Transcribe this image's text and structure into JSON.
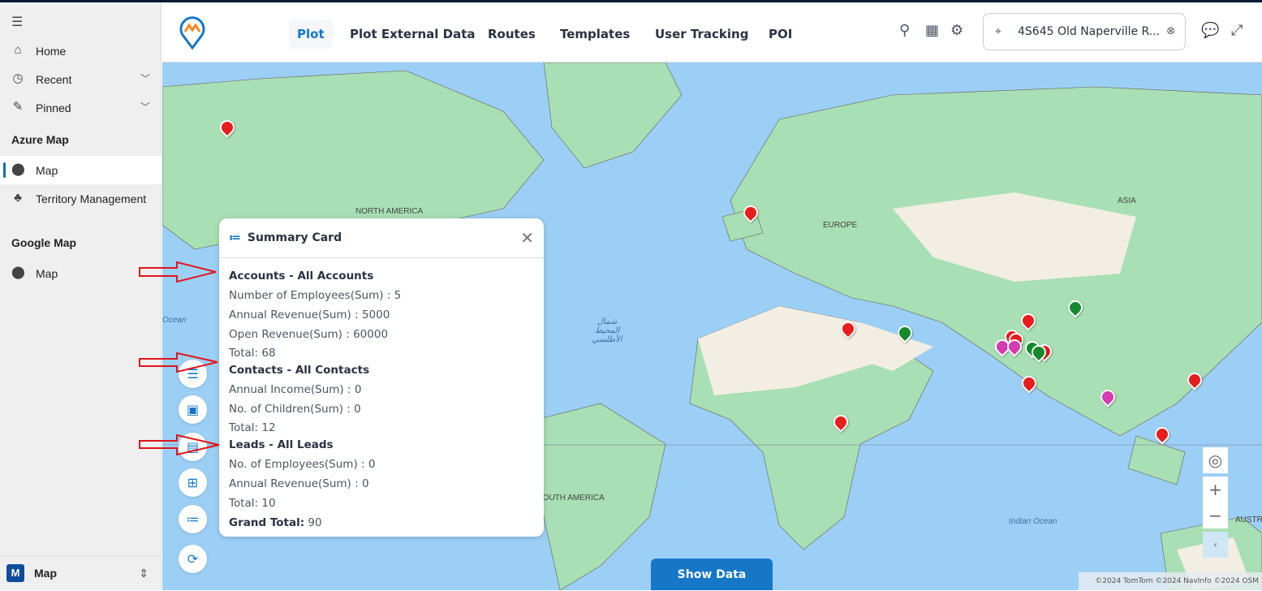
{
  "sidebar": {
    "items": [
      {
        "label": "Home",
        "icon": "home-icon"
      },
      {
        "label": "Recent",
        "icon": "clock-icon"
      },
      {
        "label": "Pinned",
        "icon": "pin-icon"
      }
    ],
    "azure_heading": "Azure Map",
    "azure_items": [
      {
        "label": "Map"
      },
      {
        "label": "Territory Management"
      }
    ],
    "google_heading": "Google Map",
    "google_items": [
      {
        "label": "Map"
      }
    ],
    "area": {
      "badge": "M",
      "label": "Map"
    }
  },
  "header": {
    "tabs": [
      "Plot",
      "Plot External Data",
      "Routes",
      "Templates",
      "User Tracking",
      "POI"
    ],
    "active_tab": "Plot",
    "address": "4S645 Old Naperville R..."
  },
  "map": {
    "labels": {
      "na": "NORTH AMERICA",
      "eu": "EUROPE",
      "asia": "ASIA",
      "sa": "SOUTH AMERICA",
      "indian": "Indian Ocean",
      "ocean": "Ocean",
      "aus": "AUSTR",
      "atlantic_ar": "شمال المحيط الأطلسي"
    },
    "attribution": "©2024 TomTom ©2024 NavInfo ©2024 OSM",
    "show_data": "Show Data",
    "marker_colors": {
      "accounts": "#e81d1d",
      "contacts": "#138a2c",
      "leads": "#d63bb1"
    }
  },
  "summary": {
    "title": "Summary Card",
    "accounts": {
      "heading": "Accounts - All Accounts",
      "lines": [
        "Number of Employees(Sum) : 5",
        "Annual Revenue(Sum) : 5000",
        "Open Revenue(Sum) : 60000"
      ],
      "total": "Total: 68"
    },
    "contacts": {
      "heading": "Contacts - All Contacts",
      "lines": [
        "Annual Income(Sum) : 0",
        "No. of Children(Sum) : 0"
      ],
      "total": "Total: 12"
    },
    "leads": {
      "heading": "Leads - All Leads",
      "lines": [
        "No. of Employees(Sum) : 0",
        "Annual Revenue(Sum) : 0"
      ],
      "total": "Total: 10"
    },
    "grand_label": "Grand Total:",
    "grand_value": "90"
  }
}
